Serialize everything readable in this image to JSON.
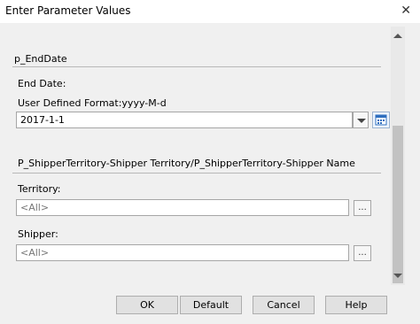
{
  "window": {
    "title": "Enter Parameter Values",
    "close_glyph": "✕"
  },
  "param1": {
    "heading": "p_EndDate",
    "label": "End Date:",
    "format": "User Defined Format:yyyy-M-d",
    "value": "2017-1-1"
  },
  "param2": {
    "heading": "P_ShipperTerritory-Shipper Territory/P_ShipperTerritory-Shipper Name",
    "territory_label": "Territory:",
    "territory_value": "<All>",
    "shipper_label": "Shipper:",
    "shipper_value": "<All>",
    "ellipsis": "..."
  },
  "buttons": {
    "ok": "OK",
    "default": "Default",
    "cancel": "Cancel",
    "help": "Help"
  },
  "icons": {
    "calendar": "calendar-icon",
    "dropdown": "chevron-down-icon",
    "close": "close-icon"
  },
  "colors": {
    "background": "#f0f0f0",
    "border": "#a6a6a6",
    "calendar_accent": "#2f6fbf"
  }
}
